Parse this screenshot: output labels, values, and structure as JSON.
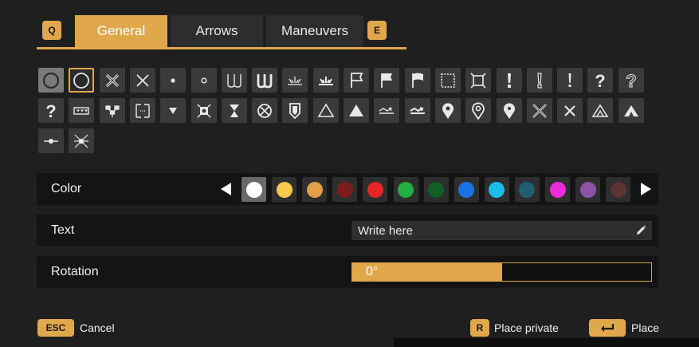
{
  "tabs": {
    "prev_key": "Q",
    "next_key": "E",
    "items": [
      {
        "label": "General",
        "active": true
      },
      {
        "label": "Arrows",
        "active": false
      },
      {
        "label": "Maneuvers",
        "active": false
      }
    ]
  },
  "marker_icons": [
    "filled-circle-icon",
    "circle-outline-icon",
    "x-bold-icon",
    "x-thin-icon",
    "small-dot-icon",
    "small-ring-icon",
    "double-u-thin-icon",
    "double-u-bold-icon",
    "sunrise-thin-icon",
    "sunrise-bold-icon",
    "flag-outline-icon",
    "flag-filled-icon",
    "flag-wave-icon",
    "dashed-square-icon",
    "square-corners-icon",
    "exclamation-bold-icon",
    "exclamation-outline-icon",
    "exclamation-icon",
    "question-bold-icon",
    "question-outline-icon",
    "question-icon",
    "minefield-sign-icon",
    "cluster-icon",
    "dotted-box-icon",
    "triangle-down-icon",
    "target-square-icon",
    "hourglass-icon",
    "crossed-circle-icon",
    "shield-icon",
    "triangle-outline-icon",
    "triangle-filled-icon",
    "wave-arrow-thin-icon",
    "wave-arrow-bold-icon",
    "map-pin-filled-icon",
    "map-pin-outline-icon",
    "map-pin-dot-icon",
    "crossed-swords-icon",
    "crossed-swords-small-icon",
    "tent-outline-icon",
    "tent-filled-icon",
    "line-dot-icon",
    "burst-icon"
  ],
  "color": {
    "label": "Color",
    "swatches": [
      "#ffffff",
      "#f6c84e",
      "#e39f45",
      "#7b1d1d",
      "#e72525",
      "#24ad43",
      "#135e26",
      "#1a73e6",
      "#1dbbea",
      "#1f5e73",
      "#ee2bdb",
      "#8b52a6",
      "#5a3333"
    ],
    "selected_index": 0
  },
  "text": {
    "label": "Text",
    "placeholder": "Write here"
  },
  "rotation": {
    "label": "Rotation",
    "value": "0°",
    "fraction": 0.5
  },
  "footer": {
    "cancel_key": "ESC",
    "cancel_label": "Cancel",
    "private_key": "R",
    "private_label": "Place private",
    "place_label": "Place"
  }
}
